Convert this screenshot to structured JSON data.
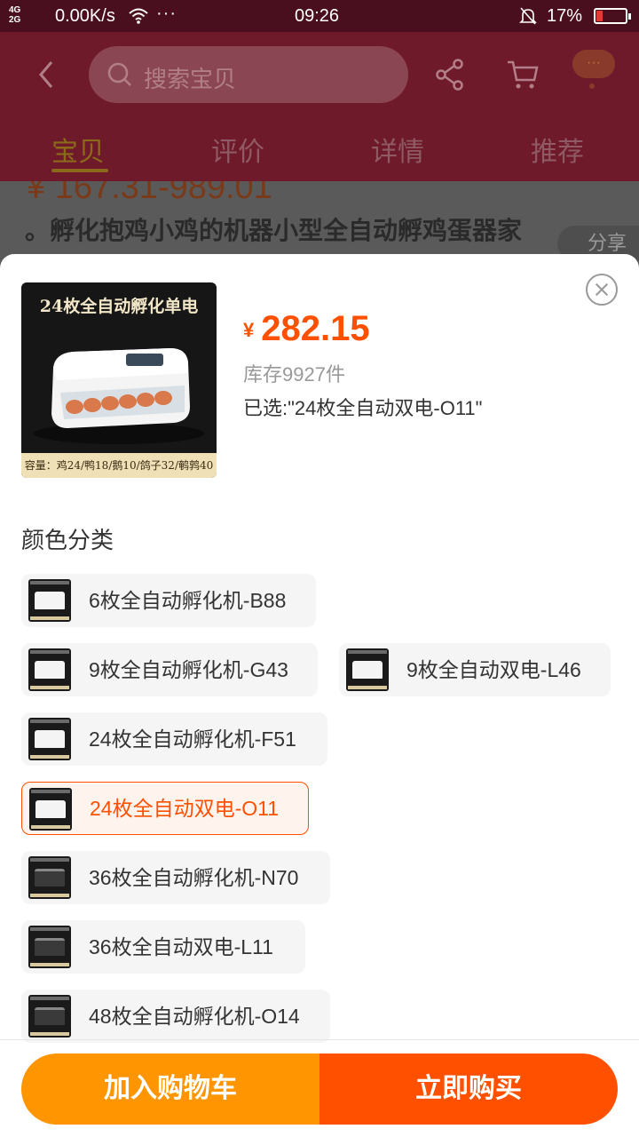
{
  "status_bar": {
    "network_top": "4G",
    "network_bottom": "2G",
    "speed": "0.00K/s",
    "dots": "···",
    "time": "09:26",
    "battery": "17%"
  },
  "header": {
    "search_placeholder": "搜索宝贝",
    "more_label": "···",
    "tabs": [
      {
        "label": "宝贝",
        "active": true
      },
      {
        "label": "评价",
        "active": false
      },
      {
        "label": "详情",
        "active": false
      },
      {
        "label": "推荐",
        "active": false
      }
    ]
  },
  "background_page": {
    "price_range": "¥ 167.31-989.01",
    "title": "。孵化抱鸡小鸡的机器小型全自动孵鸡蛋器家",
    "share_label": "分享"
  },
  "sku_sheet": {
    "product_image": {
      "title": "24枚全自动孵化单电",
      "caption": "容量：鸡24/鸭18/鹅10/鸽子32/鹌鹑40"
    },
    "currency": "¥",
    "price": "282.15",
    "stock": "库存9927件",
    "selected": "已选:\"24枚全自动双电-O11\"",
    "section_label": "颜色分类",
    "options": [
      {
        "label": "6枚全自动孵化机-B88",
        "selected": false,
        "dark": false
      },
      {
        "label": "9枚全自动孵化机-G43",
        "selected": false,
        "dark": false
      },
      {
        "label": "9枚全自动双电-L46",
        "selected": false,
        "dark": false
      },
      {
        "label": "24枚全自动孵化机-F51",
        "selected": false,
        "dark": false
      },
      {
        "label": "24枚全自动双电-O11",
        "selected": true,
        "dark": false
      },
      {
        "label": "36枚全自动孵化机-N70",
        "selected": false,
        "dark": true
      },
      {
        "label": "36枚全自动双电-L11",
        "selected": false,
        "dark": true
      },
      {
        "label": "48枚全自动孵化机-O14",
        "selected": false,
        "dark": true
      }
    ],
    "add_to_cart": "加入购物车",
    "buy_now": "立即购买"
  },
  "colors": {
    "accent": "#ff5000",
    "cart_button": "#ff9500"
  }
}
